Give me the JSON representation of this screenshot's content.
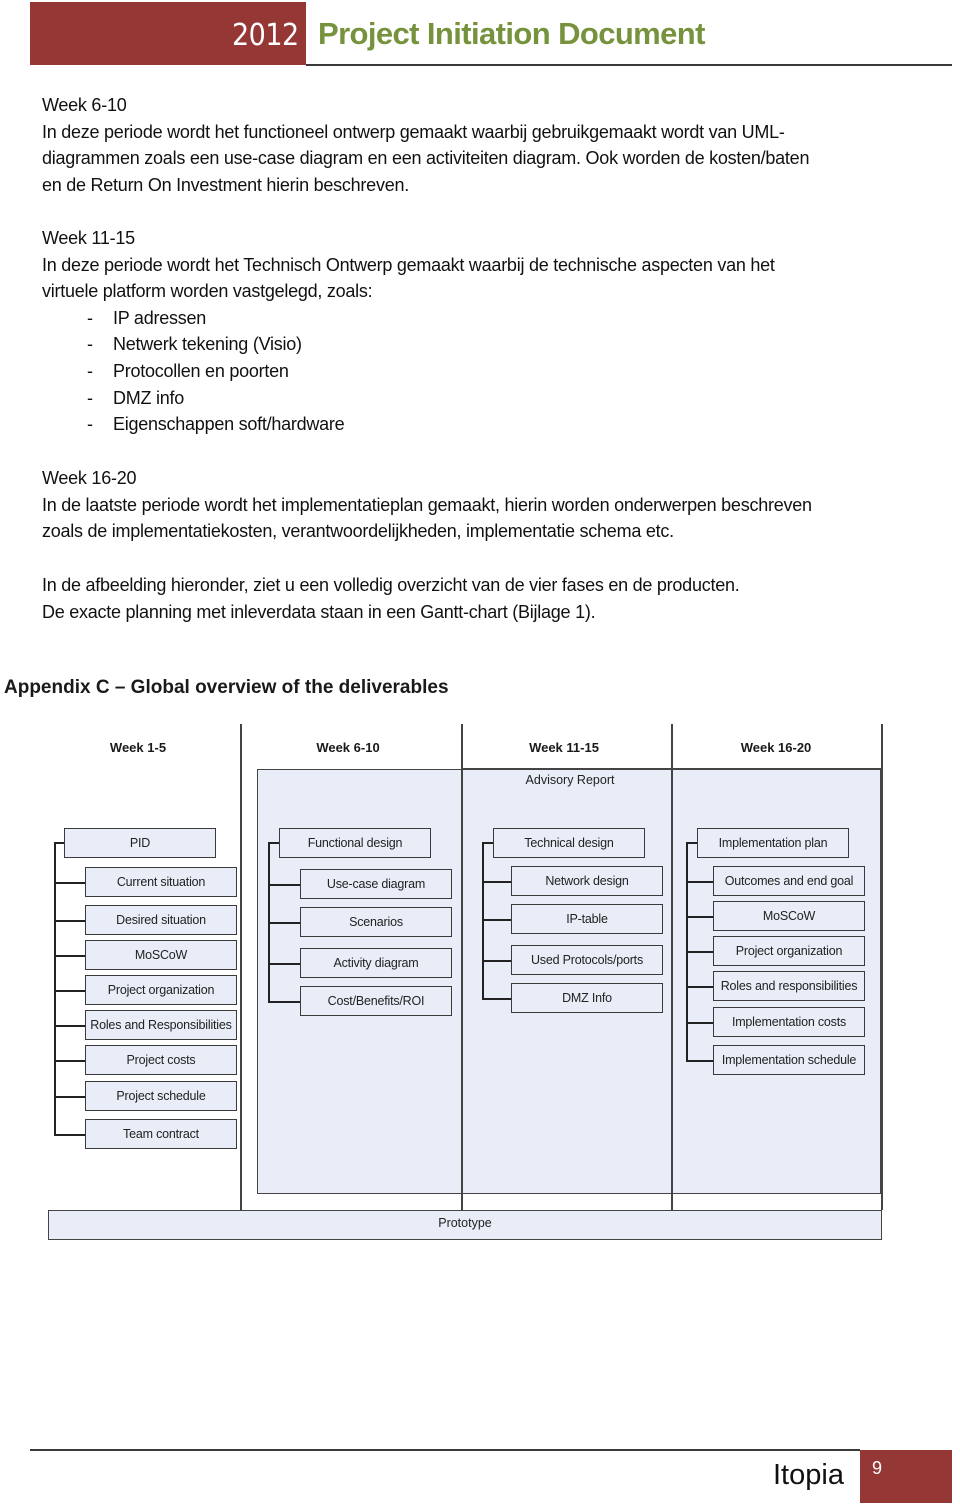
{
  "header": {
    "year": "2012",
    "title": "Project Initiation Document",
    "accent_color": "#953735",
    "title_color": "#76923c"
  },
  "body": {
    "week6": {
      "heading": "Week 6-10",
      "lines": [
        "In deze periode wordt het functioneel ontwerp gemaakt waarbij gebruikgemaakt wordt van UML-",
        "diagrammen zoals een use-case diagram en een activiteiten diagram. Ook worden de kosten/baten",
        "en de Return On Investment hierin beschreven."
      ]
    },
    "week11": {
      "heading": "Week 11-15",
      "lines": [
        "In deze periode wordt het Technisch Ontwerp gemaakt waarbij de technische aspecten van het",
        "virtuele platform worden vastgelegd,  zoals:"
      ],
      "bullet_marker": "-",
      "bullets": [
        "IP adressen",
        "Netwerk tekening (Visio)",
        "Protocollen en poorten",
        "DMZ info",
        "Eigenschappen soft/hardware"
      ]
    },
    "week16": {
      "heading": "Week 16-20",
      "lines": [
        "In de laatste periode wordt het implementatieplan gemaakt, hierin worden onderwerpen beschreven",
        "zoals de implementatiekosten, verantwoordelijkheden, implementatie schema etc."
      ]
    },
    "closing": [
      "In de afbeelding hieronder, ziet u een volledig overzicht van de vier fases en de producten.",
      "De exacte planning met inleverdata staan in een Gantt-chart (Bijlage 1)."
    ]
  },
  "diagram": {
    "title": "Appendix C – Global overview of the deliverables",
    "weeks": [
      "Week 1-5",
      "Week 6-10",
      "Week 11-15",
      "Week 16-20"
    ],
    "advisory_report": "Advisory Report",
    "prototype": "Prototype",
    "fill_color": "#e8edf7",
    "columns": [
      {
        "root": "PID",
        "children": [
          "Current situation",
          "Desired situation",
          "MoSCoW",
          "Project organization",
          "Roles and Responsibilities",
          "Project costs",
          "Project schedule",
          "Team contract"
        ]
      },
      {
        "root": "Functional design",
        "children": [
          "Use-case diagram",
          "Scenarios",
          "Activity diagram",
          "Cost/Benefits/ROI"
        ]
      },
      {
        "root": "Technical design",
        "children": [
          "Network design",
          "IP-table",
          "Used Protocols/ports",
          "DMZ Info"
        ]
      },
      {
        "root": "Implementation plan",
        "children": [
          "Outcomes and end goal",
          "MoSCoW",
          "Project organization",
          "Roles and responsibilities",
          "Implementation costs",
          "Implementation schedule"
        ]
      }
    ]
  },
  "footer": {
    "brand": "Itopia",
    "page_number": "9"
  }
}
